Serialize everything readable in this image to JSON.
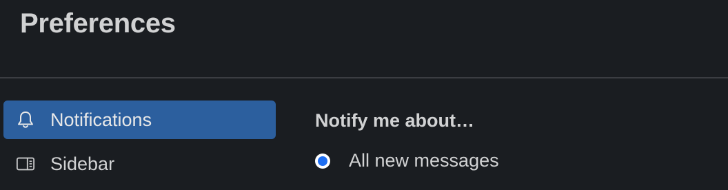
{
  "header": {
    "title": "Preferences"
  },
  "sidebar": {
    "items": [
      {
        "label": "Notifications",
        "icon": "bell-icon",
        "active": true
      },
      {
        "label": "Sidebar",
        "icon": "sidebar-layout-icon",
        "active": false
      }
    ]
  },
  "main": {
    "section_title": "Notify me about…",
    "options": [
      {
        "label": "All new messages",
        "selected": true
      }
    ]
  },
  "colors": {
    "background": "#1a1d21",
    "active_item": "#2c5f9e",
    "radio_selected": "#1d6ef2",
    "divider": "#3b3d42"
  }
}
